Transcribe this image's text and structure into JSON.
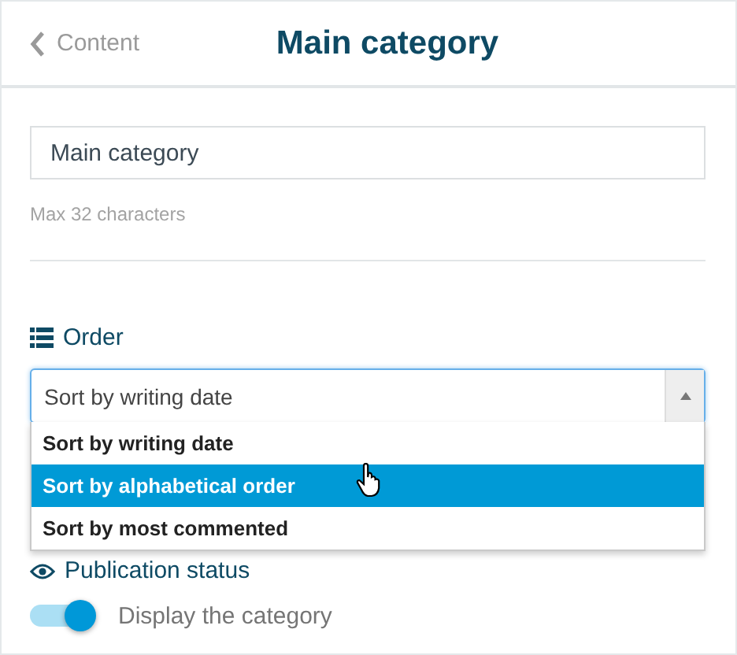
{
  "header": {
    "back_label": "Content",
    "title": "Main category"
  },
  "name_field": {
    "value": "Main category",
    "hint": "Max 32 characters"
  },
  "order": {
    "label": "Order",
    "value": "Sort by writing date",
    "expanded": true,
    "options": [
      {
        "label": "Sort by writing date",
        "highlighted": false
      },
      {
        "label": "Sort by alphabetical order",
        "highlighted": true
      },
      {
        "label": "Sort by most commented",
        "highlighted": false
      }
    ]
  },
  "publication": {
    "label": "Publication status",
    "toggle_label": "Display the category",
    "on": true
  }
}
